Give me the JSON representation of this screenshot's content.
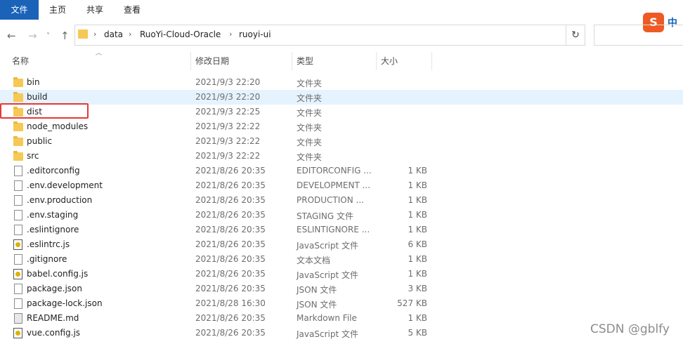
{
  "ribbon": {
    "tabs": [
      {
        "label": "文件"
      },
      {
        "label": "主页"
      },
      {
        "label": "共享"
      },
      {
        "label": "查看"
      }
    ],
    "ime": {
      "logo": "S",
      "lang": "中"
    }
  },
  "nav": {
    "back": "←",
    "forward": "→",
    "recent": "˅",
    "up": "↑",
    "breadcrumbs": [
      "data",
      "RuoYi-Cloud-Oracle",
      "ruoyi-ui"
    ],
    "sep": "›",
    "refresh": "↻"
  },
  "columns": {
    "name": "名称",
    "date": "修改日期",
    "type": "类型",
    "size": "大小"
  },
  "rows": [
    {
      "icon": "folder",
      "name": "bin",
      "date": "2021/9/3 22:20",
      "type": "文件夹",
      "size": ""
    },
    {
      "icon": "folder",
      "name": "build",
      "date": "2021/9/3 22:20",
      "type": "文件夹",
      "size": ""
    },
    {
      "icon": "folder",
      "name": "dist",
      "date": "2021/9/3 22:25",
      "type": "文件夹",
      "size": ""
    },
    {
      "icon": "folder",
      "name": "node_modules",
      "date": "2021/9/3 22:22",
      "type": "文件夹",
      "size": ""
    },
    {
      "icon": "folder",
      "name": "public",
      "date": "2021/9/3 22:22",
      "type": "文件夹",
      "size": ""
    },
    {
      "icon": "folder",
      "name": "src",
      "date": "2021/9/3 22:22",
      "type": "文件夹",
      "size": ""
    },
    {
      "icon": "file",
      "name": ".editorconfig",
      "date": "2021/8/26 20:35",
      "type": "EDITORCONFIG ...",
      "size": "1 KB"
    },
    {
      "icon": "file",
      "name": ".env.development",
      "date": "2021/8/26 20:35",
      "type": "DEVELOPMENT ...",
      "size": "1 KB"
    },
    {
      "icon": "file",
      "name": ".env.production",
      "date": "2021/8/26 20:35",
      "type": "PRODUCTION ...",
      "size": "1 KB"
    },
    {
      "icon": "file",
      "name": ".env.staging",
      "date": "2021/8/26 20:35",
      "type": "STAGING 文件",
      "size": "1 KB"
    },
    {
      "icon": "file",
      "name": ".eslintignore",
      "date": "2021/8/26 20:35",
      "type": "ESLINTIGNORE ...",
      "size": "1 KB"
    },
    {
      "icon": "js",
      "name": ".eslintrc.js",
      "date": "2021/8/26 20:35",
      "type": "JavaScript 文件",
      "size": "6 KB"
    },
    {
      "icon": "file",
      "name": ".gitignore",
      "date": "2021/8/26 20:35",
      "type": "文本文档",
      "size": "1 KB"
    },
    {
      "icon": "js",
      "name": "babel.config.js",
      "date": "2021/8/26 20:35",
      "type": "JavaScript 文件",
      "size": "1 KB"
    },
    {
      "icon": "file",
      "name": "package.json",
      "date": "2021/8/26 20:35",
      "type": "JSON 文件",
      "size": "3 KB"
    },
    {
      "icon": "file",
      "name": "package-lock.json",
      "date": "2021/8/28 16:30",
      "type": "JSON 文件",
      "size": "527 KB"
    },
    {
      "icon": "md",
      "name": "README.md",
      "date": "2021/8/26 20:35",
      "type": "Markdown File",
      "size": "1 KB"
    },
    {
      "icon": "js",
      "name": "vue.config.js",
      "date": "2021/8/26 20:35",
      "type": "JavaScript 文件",
      "size": "5 KB"
    }
  ],
  "watermark": "CSDN @gblfy"
}
